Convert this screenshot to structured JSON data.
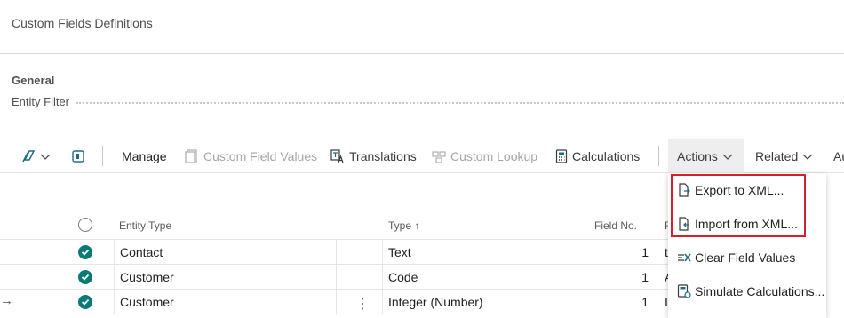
{
  "page": {
    "title": "Custom Fields Definitions"
  },
  "general": {
    "section_title": "General",
    "entity_filter_label": "Entity Filter"
  },
  "toolbar": {
    "items": {
      "manage": "Manage",
      "custom_field_values": "Custom Field Values",
      "translations": "Translations",
      "custom_lookup": "Custom Lookup",
      "calculations": "Calculations",
      "actions": "Actions",
      "related": "Related",
      "overflow": "Au"
    }
  },
  "actions_menu": {
    "items": [
      {
        "label": "Export to XML...",
        "icon": "xml-export-icon"
      },
      {
        "label": "Import from XML...",
        "icon": "xml-import-icon"
      },
      {
        "label": "Clear Field Values",
        "icon": "clear-values-icon"
      },
      {
        "label": "Simulate Calculations...",
        "icon": "simulate-calc-icon"
      }
    ],
    "highlight_color": "#d3202a"
  },
  "table": {
    "columns": {
      "entity_type": "Entity Type",
      "type": "Type",
      "type_sort_indicator": "↑",
      "field_no": "Field No.",
      "next_col": "F"
    },
    "rows": [
      {
        "entity_type": "Contact",
        "type": "Text",
        "field_no": "1",
        "next": "t",
        "selected": true
      },
      {
        "entity_type": "Customer",
        "type": "Code",
        "field_no": "1",
        "next": "A",
        "selected": true
      },
      {
        "entity_type": "Customer",
        "type": "Integer (Number)",
        "field_no": "1",
        "next": "I",
        "selected": true,
        "current": true
      }
    ],
    "row_arrow": "→",
    "row_menu": "⋮"
  },
  "colors": {
    "accent": "#0c7a74",
    "disabled_text": "#a6a6a6"
  }
}
